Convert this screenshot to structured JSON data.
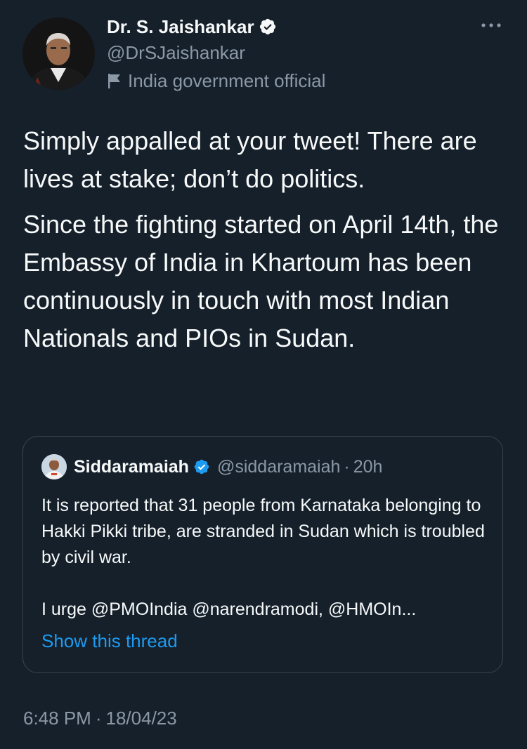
{
  "author": {
    "display_name": "Dr. S. Jaishankar",
    "handle": "@DrSJaishankar",
    "label": "India government official",
    "verified_icon": "verified-badge-icon",
    "label_icon": "flag-icon"
  },
  "tweet": {
    "paragraphs": [
      "Simply appalled at your tweet! There are lives at stake; don’t do politics.",
      "Since the fighting started on April 14th, the Embassy of India in Khartoum has been continuously in touch with most Indian Nationals and PIOs in Sudan."
    ],
    "time": "6:48 PM",
    "separator": "·",
    "date": "18/04/23"
  },
  "quote": {
    "display_name": "Siddaramaiah",
    "handle": "@siddaramaiah",
    "separator": "·",
    "time": "20h",
    "paragraphs": [
      "It is reported that 31 people from Karnataka belonging to Hakki Pikki tribe, are stranded in Sudan which is troubled by civil war.",
      "I urge @PMOIndia @narendramodi, @HMOIn..."
    ],
    "show_thread": "Show this thread"
  },
  "colors": {
    "background": "#15202b",
    "primary_text": "#f7f9f9",
    "secondary_text": "#8b98a5",
    "accent": "#1d9bf0",
    "border": "#38444d"
  }
}
